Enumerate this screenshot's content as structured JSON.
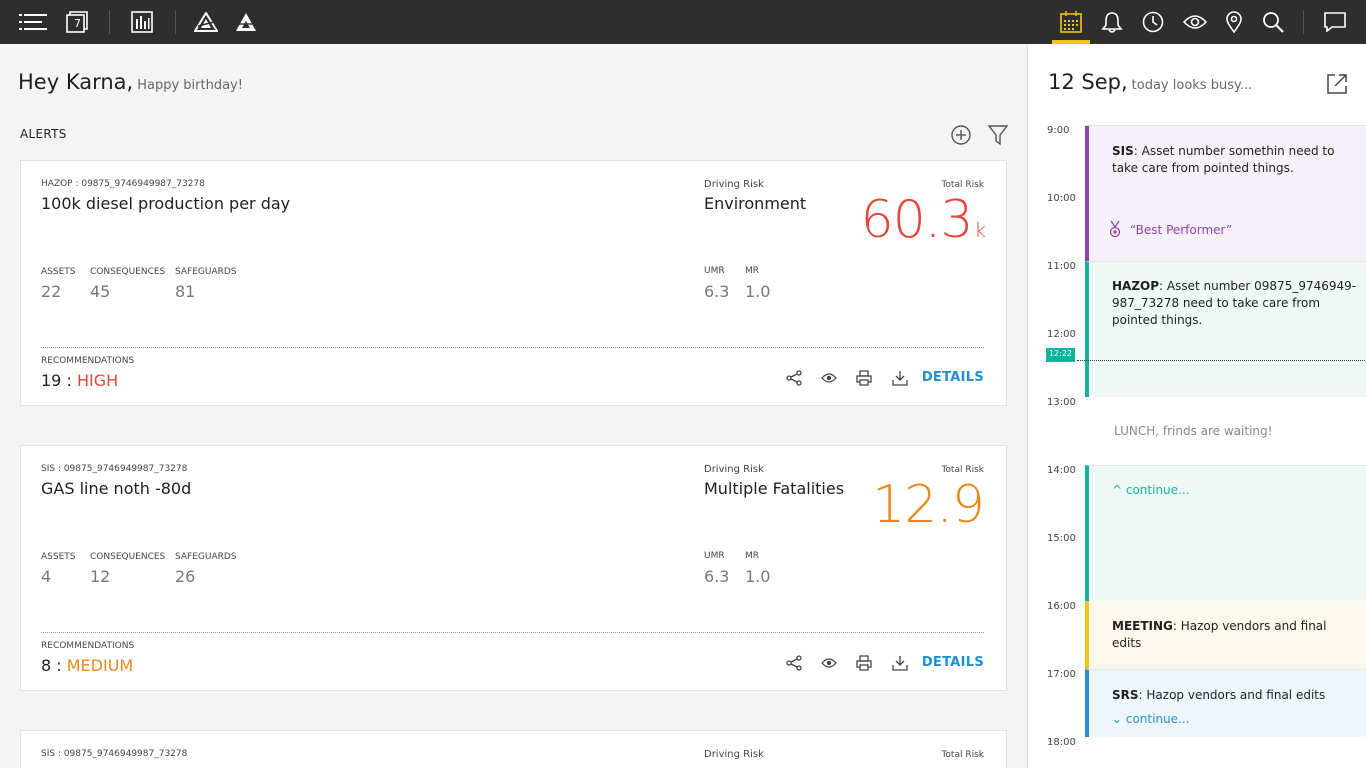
{
  "topbar": {
    "left_icons": [
      "menu-icon",
      "calendar-day-icon",
      "report-icon",
      "hazard-icon",
      "triangle-icon"
    ],
    "calendar_day_number": "7",
    "right_icons": [
      "calendar-icon",
      "bell-icon",
      "clock-icon",
      "eye-icon",
      "location-icon",
      "search-icon",
      "chat-icon"
    ],
    "active_icon": "calendar-icon",
    "accent_color": "#f2c418"
  },
  "greeting": {
    "name": "Hey Karna,",
    "sub": "Happy birthday!"
  },
  "alerts": {
    "title": "ALERTS",
    "cards": [
      {
        "code": "HAZOP : 09875_9746949987_73278",
        "title": "100k diesel production per day",
        "stats": [
          {
            "label": "ASSETS",
            "value": "22"
          },
          {
            "label": "CONSEQUENCES",
            "value": "45"
          },
          {
            "label": "SAFEGUARDS",
            "value": "81"
          }
        ],
        "driving_risk_label": "Driving Risk",
        "driving_risk": "Environment",
        "umr_label": "UMR",
        "umr": "6.3",
        "mr_label": "MR",
        "mr": "1.0",
        "total_risk_label": "Total Risk",
        "total_risk": "60.3",
        "total_risk_unit": "k",
        "risk_color": "#e2473a",
        "recommendations_label": "RECOMMENDATIONS",
        "recommendations_count": "19 :",
        "recommendations_level": "HIGH",
        "details_label": "DETAILS"
      },
      {
        "code": "SIS : 09875_9746949987_73278",
        "title": "GAS line noth -80d",
        "stats": [
          {
            "label": "ASSETS",
            "value": "4"
          },
          {
            "label": "CONSEQUENCES",
            "value": "12"
          },
          {
            "label": "SAFEGUARDS",
            "value": "26"
          }
        ],
        "driving_risk_label": "Driving Risk",
        "driving_risk": "Multiple Fatalities",
        "umr_label": "UMR",
        "umr": "6.3",
        "mr_label": "MR",
        "mr": "1.0",
        "total_risk_label": "Total Risk",
        "total_risk": "12.9",
        "total_risk_unit": "",
        "risk_color": "#e98a1f",
        "recommendations_label": "RECOMMENDATIONS",
        "recommendations_count": "8 :",
        "recommendations_level": "MEDIUM",
        "details_label": "DETAILS"
      },
      {
        "code": "SIS : 09875_9746949987_73278",
        "driving_risk_label": "Driving Risk",
        "total_risk_label": "Total Risk"
      }
    ]
  },
  "schedule": {
    "date": "12 Sep,",
    "date_sub": "today looks busy...",
    "hours": [
      "9:00",
      "10:00",
      "11:00",
      "12:00",
      "13:00",
      "14:00",
      "15:00",
      "16:00",
      "17:00",
      "18:00"
    ],
    "now": "12:22",
    "events": [
      {
        "tag": "SIS",
        "text": ": Asset number somethin need to take care from pointed things.",
        "badge": "“Best Performer”",
        "bar_color": "#8e44ad",
        "bg": "#f6f0f9",
        "badge_color": "#8e44ad"
      },
      {
        "tag": "HAZOP",
        "text": ": Asset number 09875_9746949-987_73278 need to take care from pointed things.",
        "bar_color": "#12b39c",
        "bg": "#f0f8f6"
      },
      {
        "text": "LUNCH, frinds are waiting!"
      },
      {
        "link": "^ continue...",
        "bar_color": "#12b39c",
        "bg": "#f0f8f6",
        "link_color": "#12b39c"
      },
      {
        "tag": "MEETING",
        "text": ": Hazop vendors and final edits",
        "bar_color": "#f2c418",
        "bg": "#fdf8ee"
      },
      {
        "tag": "SRS",
        "text": ": Hazop vendors and final edits",
        "link": "⌄ continue...",
        "bar_color": "#2c8fd4",
        "bg": "#eef5fb",
        "link_color": "#2c8fd4"
      }
    ]
  }
}
